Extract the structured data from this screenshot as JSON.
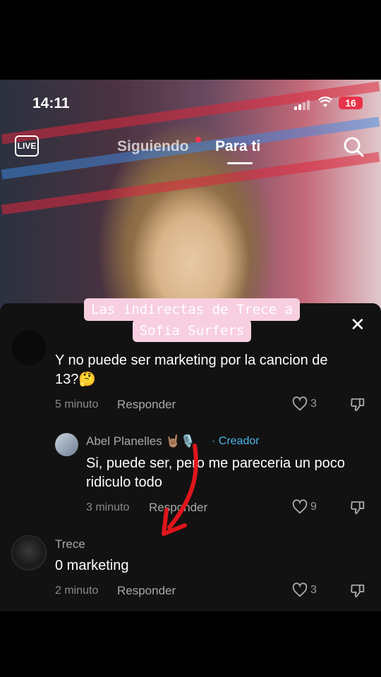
{
  "status": {
    "time": "14:11",
    "battery": "16"
  },
  "nav": {
    "following": "Siguiendo",
    "for_you": "Para ti",
    "live_label": "LIVE"
  },
  "caption": {
    "line1": "Las indirectas de Trece a",
    "line2": "Sofia Surfers"
  },
  "comments": [
    {
      "text_line1": "Y no puede ser marketing por la cancion de",
      "text_line2": "13?🤔",
      "time": "5 minuto",
      "reply": "Responder",
      "likes": "3"
    },
    {
      "user": "Abel Planelles 🤘🏽🎙️",
      "creator_tag": "· Creador",
      "text_line1": "Si, puede ser, pero me pareceria un poco",
      "text_line2": "ridiculo todo",
      "time": "3 minuto",
      "reply": "Responder",
      "likes": "9"
    },
    {
      "user": "Trece",
      "text_line1": "0 marketing",
      "time": "2 minuto",
      "reply": "Responder",
      "likes": "3"
    }
  ],
  "colors": {
    "accent_pink": "#f7cfe0",
    "creator_blue": "#4cb3e8",
    "arrow_red": "#e0151b",
    "sheet_bg": "#121212"
  }
}
